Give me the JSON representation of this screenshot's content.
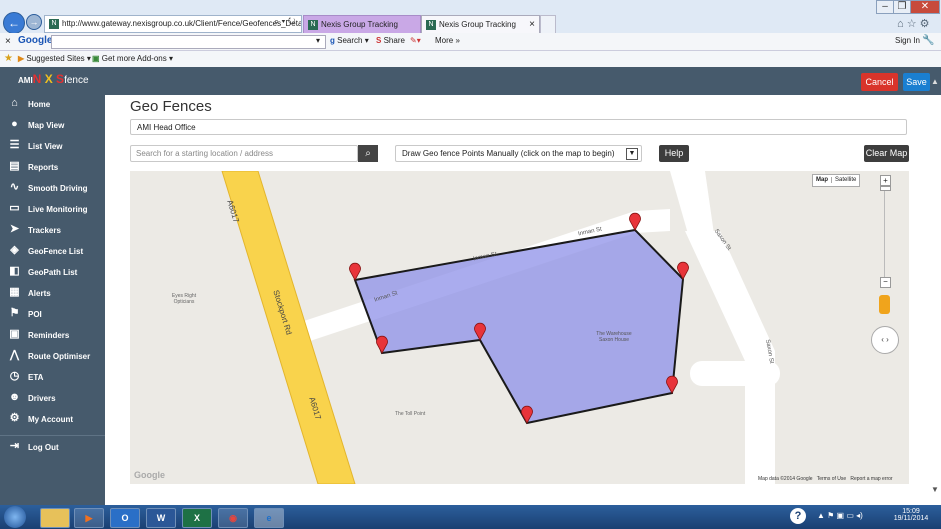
{
  "browser": {
    "address": "http://www.gateway.nexisgroup.co.uk/Client/Fence/Geofences_Deta",
    "tabs": [
      "Nexis Group Tracking",
      "Nexis Group Tracking"
    ],
    "tab_close": "×"
  },
  "google_toolbar": {
    "close": "×",
    "brand": "Google",
    "search": "Search",
    "share": "Share",
    "more": "More »",
    "sign_in": "Sign In"
  },
  "favorites": {
    "suggested": "Suggested Sites ▾",
    "addons": "Get more Add-ons ▾"
  },
  "app": {
    "logo_prefix": "AMI",
    "logo_letters": [
      "N",
      "X",
      "S"
    ],
    "logo_suffix": "fence",
    "cancel": "Cancel",
    "save": "Save"
  },
  "sidebar": {
    "items": [
      {
        "label": "Home",
        "icon": "home-icon"
      },
      {
        "label": "Map View",
        "icon": "map-marker-icon"
      },
      {
        "label": "List View",
        "icon": "list-icon"
      },
      {
        "label": "Reports",
        "icon": "reports-icon"
      },
      {
        "label": "Smooth Driving",
        "icon": "smooth-driving-icon"
      },
      {
        "label": "Live Monitoring",
        "icon": "monitor-icon"
      },
      {
        "label": "Trackers",
        "icon": "tracker-icon"
      },
      {
        "label": "GeoFence List",
        "icon": "geofence-icon"
      },
      {
        "label": "GeoPath List",
        "icon": "geopath-icon"
      },
      {
        "label": "Alerts",
        "icon": "calendar-icon"
      },
      {
        "label": "POI",
        "icon": "flag-icon"
      },
      {
        "label": "Reminders",
        "icon": "reminder-icon"
      },
      {
        "label": "Route Optimiser",
        "icon": "route-icon"
      },
      {
        "label": "ETA",
        "icon": "clock-icon"
      },
      {
        "label": "Drivers",
        "icon": "driver-icon"
      },
      {
        "label": "My Account",
        "icon": "gear-icon"
      },
      {
        "label": "Log Out",
        "icon": "logout-icon"
      }
    ]
  },
  "main": {
    "title": "Geo Fences",
    "name_value": "AMI Head Office",
    "search_placeholder": "Search for a starting location / address",
    "draw_select": "Draw Geo fence Points Manually (click on the map to begin)",
    "help": "Help",
    "clear_map": "Clear Map"
  },
  "map": {
    "type_map": "Map",
    "type_satellite": "Satellite",
    "zoom_in": "+",
    "zoom_out": "−",
    "labels": {
      "a6017_top": "A6017",
      "stockport": "Stockport Rd",
      "a6017_bottom": "A6017",
      "inman_top": "Inman St",
      "inman_mid": "Inman St",
      "inman_left": "Inman St",
      "saxon_top": "Saxon St",
      "saxon_right": "Saxon St",
      "eyes": "Eyes Right Opticians",
      "warehouse": "The Warehouse Saxon House",
      "toll": "The Toll Point",
      "google": "Google"
    },
    "footer": {
      "data": "Map data ©2014 Google",
      "terms": "Terms of Use",
      "report": "Report a map error"
    },
    "fence_fill": "#8e90e8",
    "fence_stroke": "#1a1a1a"
  },
  "taskbar": {
    "time": "15:09",
    "date": "19/11/2014",
    "help": "?"
  },
  "colors": {
    "header": "#465a6c",
    "cancel": "#d9342b",
    "save": "#1a7fd1",
    "road_major": "#f9d34c"
  }
}
